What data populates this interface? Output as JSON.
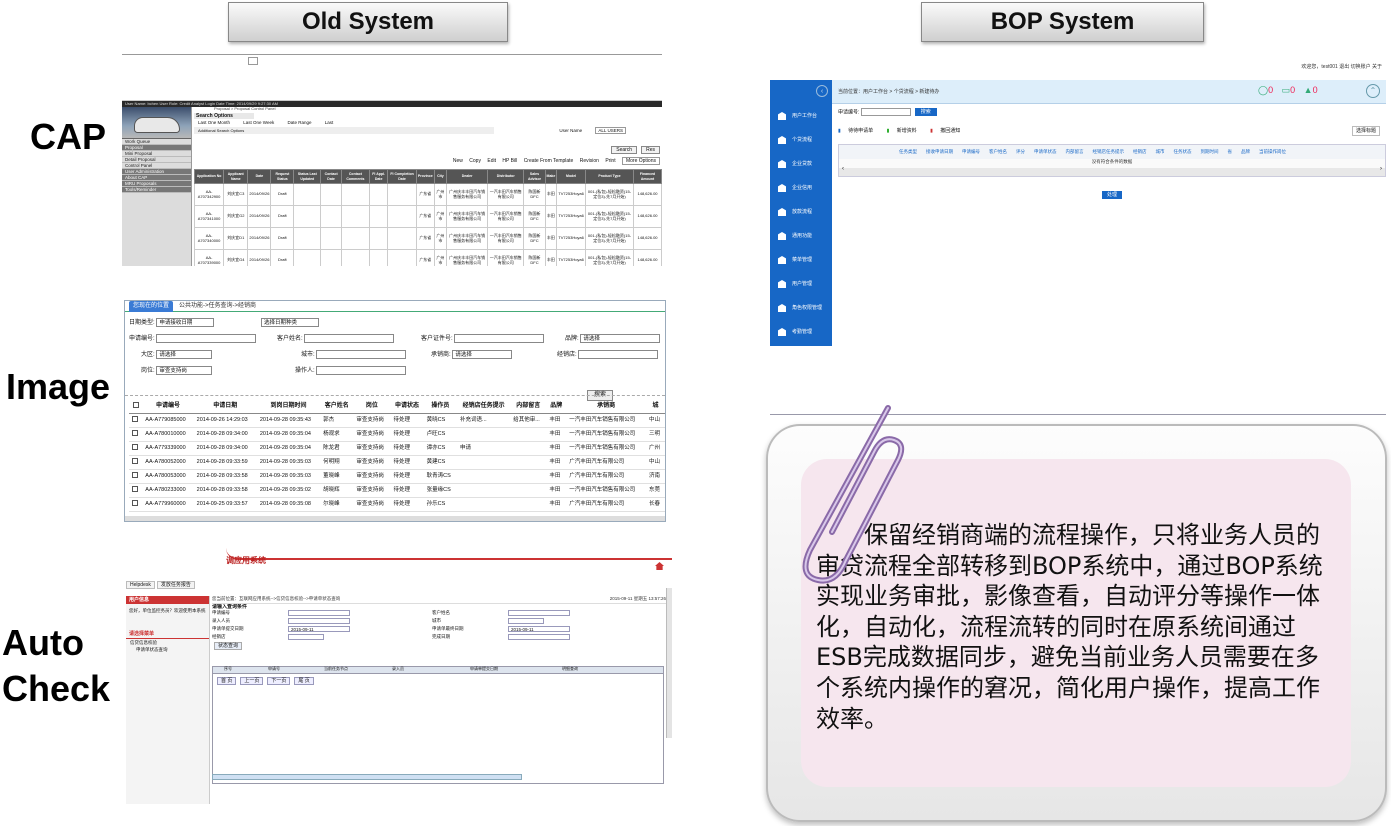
{
  "headers": {
    "old": "Old System",
    "bop": "BOP System"
  },
  "labels": {
    "cap": "CAP",
    "image": "Image",
    "auto1": "Auto",
    "auto2": "Check"
  },
  "cap": {
    "blackbar": "User Name: bchen   User Role: Credit Analyst   Login Date Time: 2014/09/29 9:27:30 AM",
    "menu": [
      "Work Queue",
      "Proposal",
      "Mini Proposal",
      "Detail Proposal",
      "Control Panel",
      "User Administration",
      "About CAP",
      "MRU Proposals",
      "Tools/Reminder"
    ],
    "crumb": "Proposal > Proposal Control Panel",
    "search_options": "Search Options",
    "radios": [
      "Last One Month",
      "Last One Week",
      "Date Range",
      "Last"
    ],
    "user_name_label": "User Name",
    "user_name_value": "ALL USERS",
    "advanced": "Additional Search Options",
    "search": "Search",
    "reset": "Res",
    "actions": [
      "New",
      "Copy",
      "Edit",
      "HP Bill",
      "Create From Template",
      "Revision",
      "Print",
      "More Options"
    ],
    "columns": [
      "Application No",
      "Applicant Name",
      "Date",
      "Request Status",
      "Status Last Updated",
      "Contact Date",
      "Contact Comments",
      "FI Appl. Date",
      "FI Completion Date",
      "Province",
      "City",
      "Dealer",
      "Distributor",
      "Sales Advisor",
      "Make",
      "Model",
      "Product Type",
      "Financed Amount"
    ],
    "rows": [
      [
        "AA-A707342900",
        "刘庆宜C3",
        "2014/09/26",
        "Draft",
        "",
        "",
        "",
        "",
        "",
        "广东省",
        "广州市",
        "广州庆丰丰田汽车销售服务有限公司",
        "一汽丰田汽车销售有限公司",
        "陈国新 DFC",
        "丰田",
        "TV7253Hoya6",
        "001-(私包)-轻松融资(15-定位3)-先7月开始)",
        "148,626.00"
      ],
      [
        "AA-A707341000",
        "刘庆宜G2",
        "2014/09/26",
        "Draft",
        "",
        "",
        "",
        "",
        "",
        "广东省",
        "广州市",
        "广州庆丰丰田汽车销售服务有限公司",
        "一汽丰田汽车销售有限公司",
        "陈国新 DFC",
        "丰田",
        "TV7253Hoya6",
        "001-(私包)-轻松融资(15-定位3)-先7月开始)",
        "148,626.00"
      ],
      [
        "AA-A707340000",
        "刘庆宜D1",
        "2014/09/26",
        "Draft",
        "",
        "",
        "",
        "",
        "",
        "广东省",
        "广州市",
        "广州庆丰丰田汽车销售服务有限公司",
        "一汽丰田汽车销售有限公司",
        "陈国新 DFC",
        "丰田",
        "TV7253Hoya6",
        "001-(私包)-轻松融资(15-定位3)-先7月开始)",
        "148,626.00"
      ],
      [
        "AA-A707339000",
        "刘庆宜G4",
        "2014/09/26",
        "Draft",
        "",
        "",
        "",
        "",
        "",
        "广东省",
        "广州市",
        "广州庆丰丰田汽车销售服务有限公司",
        "一汽丰田汽车销售有限公司",
        "陈国新 DFC",
        "丰田",
        "TV7253Hoya6",
        "001-(私包)-轻松融资(15-定位3)-先7月开始)",
        "148,626.00"
      ]
    ]
  },
  "image": {
    "tab": "您现在的位置",
    "path": "公共功能->任务查询->经销商",
    "f_datetype": "日期类型:",
    "f_datetype_val": "申请接收日期",
    "f_choose": "选择日期种类",
    "f_appno": "申请编号:",
    "f_custname": "客户姓名:",
    "f_idno": "客户证件号:",
    "f_brand": "品牌:",
    "f_brand_val": "请选择",
    "f_region": "大区:",
    "f_region_val": "请选择",
    "f_city": "城市:",
    "f_bank": "承销商:",
    "f_bank_val": "请选择",
    "f_dealer": "经销店:",
    "f_post": "岗位:",
    "f_post_val": "审查支持岗",
    "f_oper": "操作人:",
    "search": "搜索",
    "columns": [
      "申请编号",
      "申请日期",
      "到岗日期时间",
      "客户姓名",
      "岗位",
      "申请状态",
      "操作员",
      "经销店任务提示",
      "内部留言",
      "品牌",
      "承销商",
      "城"
    ],
    "rows": [
      [
        "AA-A779085000",
        "2014-09-26 14:29:03",
        "2014-09-28 09:35:43",
        "郭杰",
        "审查支持岗",
        "待处理",
        "黄晓CS",
        "补充词语...",
        "给其他审...",
        "丰田",
        "一汽丰田汽车销售有限公司",
        "中山"
      ],
      [
        "AA-A780010000",
        "2014-09-28 09:34:00",
        "2014-09-28 09:35:04",
        "杨观求",
        "审查支持岗",
        "待处理",
        "卢旺CS",
        "",
        "",
        "丰田",
        "一汽丰田汽车销售有限公司",
        "三明"
      ],
      [
        "AA-A779339000",
        "2014-09-28 09:34:00",
        "2014-09-28 09:35:04",
        "陈龙君",
        "审查支持岗",
        "待处理",
        "谭亦CS",
        "申请",
        "",
        "丰田",
        "一汽丰田汽车销售有限公司",
        "广州"
      ],
      [
        "AA-A780052000",
        "2014-09-28 09:33:59",
        "2014-09-28 09:35:03",
        "何明翔",
        "审查支持岗",
        "待处理",
        "黄建CS",
        "",
        "",
        "丰田",
        "广汽丰田汽车有限公司",
        "中山"
      ],
      [
        "AA-A780053000",
        "2014-09-28 09:33:58",
        "2014-09-28 09:35:03",
        "董晓峰",
        "审查支持岗",
        "待处理",
        "耿青涛CS",
        "",
        "",
        "丰田",
        "广汽丰田汽车有限公司",
        "济南"
      ],
      [
        "AA-A780233000",
        "2014-09-28 09:33:58",
        "2014-09-28 09:35:02",
        "胡晓辉",
        "审查支持岗",
        "待处理",
        "张量缘CS",
        "",
        "",
        "丰田",
        "一汽丰田汽车销售有限公司",
        "东莞"
      ],
      [
        "AA-A779960000",
        "2014-09-25 09:33:57",
        "2014-09-28 09:35:08",
        "尔晓峰",
        "审查支持岗",
        "待处理",
        "孙乐CS",
        "",
        "",
        "丰田",
        "广汽丰田汽车有限公司",
        "长春"
      ]
    ]
  },
  "auto": {
    "title": "调应用系统",
    "tabs": [
      "Helpdesk",
      "发放任务报告"
    ],
    "user_header": "用户信息",
    "user_text": "您好，单位监控务员？欢迎使用本系统",
    "menu_header": "请选择菜单",
    "menu": [
      "信贷信息校验",
      "申请单状态查询"
    ],
    "breadcrumb": "您当前位置：互联网应用系统-->信贷信息校验-->申请单状态查询",
    "datetime": "2015-09-11 星期五 13:57:26",
    "cond": "请输入查询条件",
    "f1": "申请编号",
    "f2": "录入人员",
    "f3": "申请单提交日期",
    "f3v": "2015-09-11",
    "f4": "经销店",
    "f5": "客户姓名",
    "f6": "城市",
    "f7": "申请单最终日期",
    "f7v": "2015-09-11",
    "f8": "完成日期",
    "subtab": "状态查询",
    "cols": [
      "序号",
      "申请号",
      "当前任务节点",
      "录入员",
      "申请单提交日期",
      "明细查询"
    ],
    "pager": [
      "首 页",
      "上一页",
      "下一页",
      "尾 页"
    ]
  },
  "bop": {
    "top": "欢迎您，test001   退出   切换账户   关于",
    "nav": [
      "用户工作台",
      "个贷流程",
      "企业贷款",
      "企业信用",
      "放款流程",
      "通用功能",
      "菜单管理",
      "用户管理",
      "角色权限管理",
      "考勤管理"
    ],
    "crumb": "当前位置：用户工作台 > 个贷流程 > 新建待办",
    "counts": [
      "0",
      "0",
      "0"
    ],
    "q_label": "申请编号:",
    "q_btn": "搜索",
    "acts": [
      "待待申请单",
      "新增资料",
      "撤回通知"
    ],
    "select": "选择标题",
    "cols": [
      "任务类型",
      "接收申请日期",
      "申请编号",
      "客户姓名",
      "评分",
      "申请单状态",
      "内部留言",
      "经销店任务提示",
      "经销店",
      "城市",
      "任务状态",
      "到期时间",
      "省",
      "品牌",
      "当前操作岗位"
    ],
    "empty": "没有符合条件的数据",
    "ok": "处理"
  },
  "callout": {
    "text": "保留经销商端的流程操作，只将业务人员的审贷流程全部转移到BOP系统中，通过BOP系统实现业务审批，影像查看，自动评分等操作一体化，自动化，流程流转的同时在原系统间通过ESB完成数据同步，避免当前业务人员需要在多个系统内操作的窘况，简化用户操作，提高工作效率。"
  }
}
